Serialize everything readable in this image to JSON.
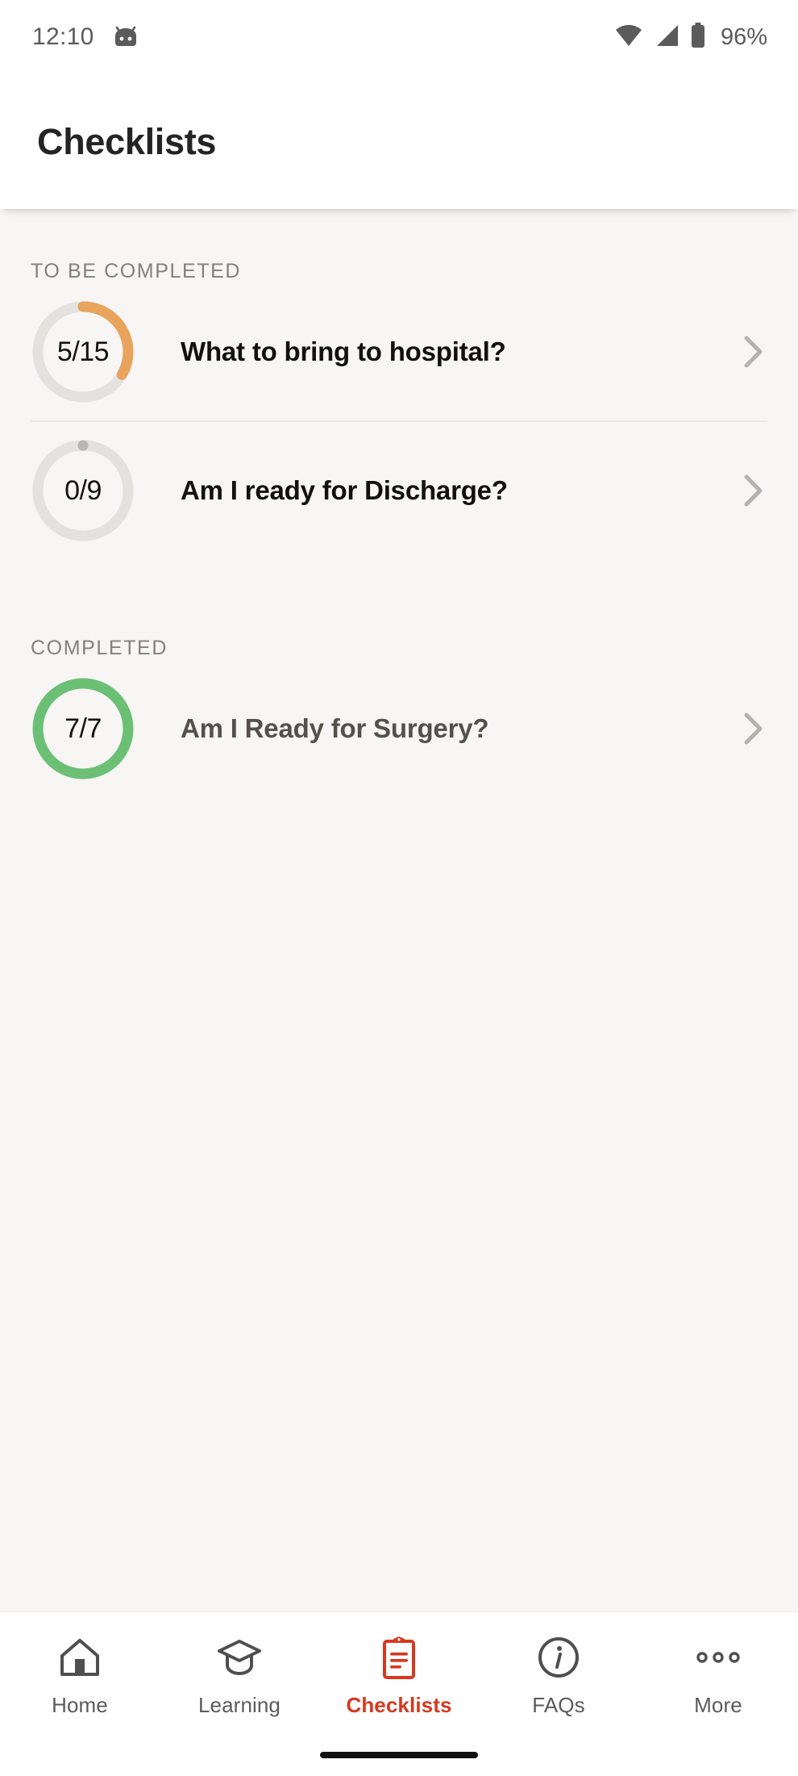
{
  "status_bar": {
    "time": "12:10",
    "battery_percent": "96%",
    "icons": [
      "android-robot-icon",
      "wifi-icon",
      "cellular-signal-icon",
      "battery-icon"
    ]
  },
  "header": {
    "title": "Checklists"
  },
  "colors": {
    "background": "#f7f6f4",
    "surface": "#ffffff",
    "accent_red": "#d6391f",
    "progress_orange": "#e8a45c",
    "progress_green": "#6bc075",
    "track_gray": "#e4e2df",
    "text_primary": "#111111",
    "text_muted": "#84807c"
  },
  "sections": [
    {
      "label": "TO BE COMPLETED",
      "items": [
        {
          "progress_text": "5/15",
          "completed": 5,
          "total": 15,
          "percent": 33,
          "title": "What to bring to hospital?",
          "ring_color": "#e8a45c",
          "state": "in-progress"
        },
        {
          "progress_text": "0/9",
          "completed": 0,
          "total": 9,
          "percent": 0,
          "title": "Am I ready for Discharge?",
          "ring_color": "#b9b6b2",
          "state": "not-started"
        }
      ]
    },
    {
      "label": "COMPLETED",
      "items": [
        {
          "progress_text": "7/7",
          "completed": 7,
          "total": 7,
          "percent": 100,
          "title": "Am I Ready for Surgery?",
          "ring_color": "#6bc075",
          "state": "complete"
        }
      ]
    }
  ],
  "bottom_nav": {
    "active_index": 2,
    "items": [
      {
        "label": "Home",
        "icon": "home-icon"
      },
      {
        "label": "Learning",
        "icon": "graduation-cap-icon"
      },
      {
        "label": "Checklists",
        "icon": "clipboard-icon"
      },
      {
        "label": "FAQs",
        "icon": "info-circle-icon"
      },
      {
        "label": "More",
        "icon": "more-dots-icon"
      }
    ]
  }
}
